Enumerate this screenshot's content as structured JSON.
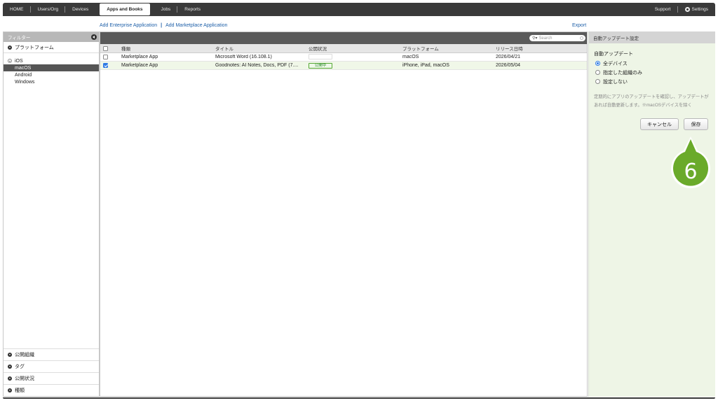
{
  "nav": {
    "items": [
      {
        "label": "HOME"
      },
      {
        "label": "Users/Org"
      },
      {
        "label": "Devices"
      },
      {
        "label": "Apps and Books"
      },
      {
        "label": "Jobs"
      },
      {
        "label": "Reports"
      }
    ],
    "active": "Apps and Books",
    "support": "Support",
    "settings": "Settings"
  },
  "actions": {
    "add_enterprise": "Add Enterprise Application",
    "separator": "|",
    "add_marketplace": "Add Marketplace Application",
    "export": "Export"
  },
  "filter": {
    "header": "フィルター",
    "platform_label": "プラットフォーム",
    "tree": {
      "ios": "iOS",
      "macos": "macOS",
      "android": "Android",
      "windows": "Windows"
    },
    "bottom_sections": [
      {
        "label": "公開組織"
      },
      {
        "label": "タグ"
      },
      {
        "label": "公開状況"
      },
      {
        "label": "種類"
      }
    ]
  },
  "table": {
    "search_placeholder": "Search",
    "columns": [
      "種類",
      "タイトル",
      "公開状況",
      "プラットフォーム",
      "リリース日時"
    ],
    "rows": [
      {
        "type": "Marketplace App",
        "title": "Microsoft Word (16.108.1)",
        "status": "",
        "platform": "macOS",
        "release": "2026/04/21",
        "checked": false
      },
      {
        "type": "Marketplace App",
        "title": "Goodnotes: AI Notes, Docs, PDF (7....",
        "status": "公開中",
        "platform": "iPhone, iPad, macOS",
        "release": "2026/05/04",
        "checked": true
      }
    ]
  },
  "panel": {
    "header": "自動アップデート設定",
    "title": "自動アップデート",
    "options": [
      {
        "label": "全デバイス",
        "selected": true
      },
      {
        "label": "指定した組織のみ",
        "selected": false
      },
      {
        "label": "設定しない",
        "selected": false
      }
    ],
    "description": "定期的にアプリのアップデートを確認し、アップデートがあれば自動更新します。※macOSデバイスを除く",
    "cancel": "キャンセル",
    "save": "保存"
  },
  "callout": {
    "number": "6",
    "color": "#6aaa2a"
  },
  "colors": {
    "nav_bg": "#3a3a3a",
    "link": "#1d5fa8",
    "selected_row": "#f0f7e8",
    "panel_bg": "#eef5e6",
    "checkbox_on": "#2f7ae5"
  }
}
